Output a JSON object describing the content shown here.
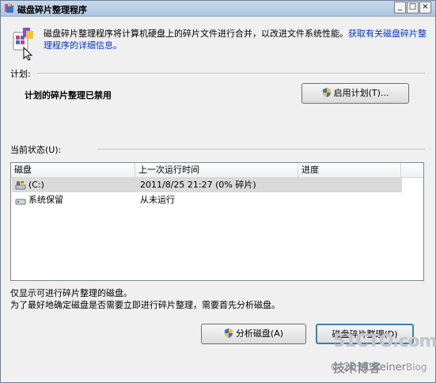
{
  "window": {
    "title": "磁盘碎片整理程序"
  },
  "controls": {
    "minimize": "_",
    "maximize": "□",
    "close": "×"
  },
  "intro": {
    "text": "磁盘碎片整理程序将计算机硬盘上的碎片文件进行合并，以改进文件系统性能。",
    "link": "获取有关磁盘碎片整理程序的详细信息。"
  },
  "schedule": {
    "section_label": "计划:",
    "status": "计划的碎片整理已禁用",
    "enable_button": "启用计划(T)..."
  },
  "current": {
    "section_label": "当前状态(U):",
    "columns": [
      "磁盘",
      "上一次运行时间",
      "进度"
    ],
    "rows": [
      {
        "disk": "(C:)",
        "last_run": "2011/8/25 21:27 (0% 碎片)",
        "progress": ""
      },
      {
        "disk": "系统保留",
        "last_run": "从未运行",
        "progress": ""
      }
    ]
  },
  "notes": {
    "line1": "仅显示可进行碎片整理的磁盘。",
    "line2": "为了最好地确定磁盘是否需要立即进行碎片整理，需要首先分析磁盘。"
  },
  "buttons": {
    "analyze": "分析磁盘(A)",
    "defrag": "磁盘碎片整理(D)"
  },
  "watermark": {
    "brand": "51CTO.com",
    "sub": "技术博客",
    "blog": "Blog",
    "copyright": "© 2011 Reiner"
  },
  "colors": {
    "link": "#0033cc",
    "titlebar": "#aec5e1",
    "selection": "#dadada"
  },
  "icons": [
    "defrag-app-icon",
    "shield-icon",
    "drive-c-icon",
    "drive-reserved-icon",
    "mouse-cursor-icon"
  ]
}
